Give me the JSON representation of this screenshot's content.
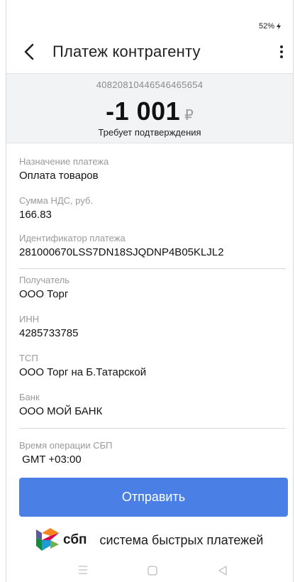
{
  "status_bar": {
    "battery": "52%",
    "charging_icon": "bolt-icon"
  },
  "app_bar": {
    "back_icon": "arrow-left-icon",
    "title": "Платеж контрагенту",
    "menu_icon": "more-vertical-icon"
  },
  "summary": {
    "account": "40820810446546465654",
    "amount": "-1 001",
    "currency": "₽",
    "status": "Требует подтверждения"
  },
  "fields": [
    {
      "label": "Назначение платежа",
      "value": "Оплата товаров"
    },
    {
      "label": "Сумма НДС, руб.",
      "value": "166.83"
    },
    {
      "label": "Идентификатор платежа",
      "value": "281000670LSS7DN18SJQDNP4B05KLJL2"
    },
    {
      "label": "Получатель",
      "value": "ООО Торг"
    },
    {
      "label": "ИНН",
      "value": "4285733785"
    },
    {
      "label": "ТСП",
      "value": "ООО Торг на Б.Татарской"
    },
    {
      "label": "Банк",
      "value": "ООО МОЙ БАНК"
    },
    {
      "label": "Время операции СБП",
      "value": " GMT +03:00"
    }
  ],
  "actions": {
    "send_label": "Отправить"
  },
  "sbp": {
    "logo_word": "сбп",
    "tagline": "система быстрых платежей"
  },
  "nav": {
    "menu_icon": "recents-icon",
    "home_icon": "home-icon",
    "back_icon": "back-triangle-icon"
  },
  "colors": {
    "primary": "#4a7fe6",
    "summary_bg": "#f2f3f5",
    "muted_text": "#9a9a9a"
  }
}
